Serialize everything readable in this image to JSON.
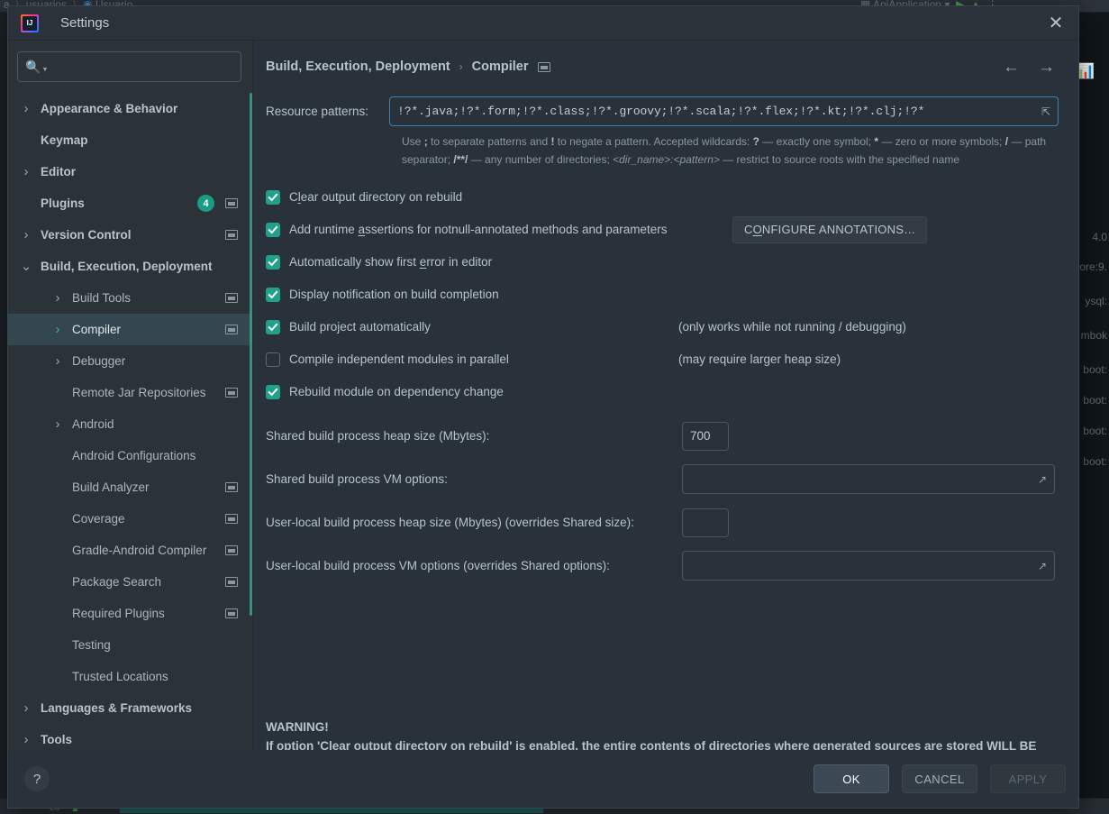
{
  "backdrop": {
    "breadcrumb_left": "a",
    "breadcrumb_mid": "usuarios",
    "breadcrumb_right": "Usuario",
    "run_config": "ApiApplication",
    "right_icon": "profiler-icon",
    "dependencies": [
      "4.0",
      "ore:9.",
      "ysql:",
      "mbok",
      "boot:",
      "boot:",
      "boot:",
      "boot:"
    ],
    "status_count": "20"
  },
  "dialog": {
    "title": "Settings",
    "logo": "intellij-idea-logo",
    "close_label": "✕"
  },
  "search": {
    "value": "",
    "placeholder": ""
  },
  "sidebar": {
    "items": [
      {
        "label": "Appearance & Behavior",
        "arrow": "collapsed",
        "indent": 0,
        "bold": true,
        "badge": null,
        "project_icon": false,
        "selected": false
      },
      {
        "label": "Keymap",
        "arrow": "none",
        "indent": 0,
        "bold": true,
        "badge": null,
        "project_icon": false,
        "selected": false
      },
      {
        "label": "Editor",
        "arrow": "collapsed",
        "indent": 0,
        "bold": true,
        "badge": null,
        "project_icon": false,
        "selected": false
      },
      {
        "label": "Plugins",
        "arrow": "none",
        "indent": 0,
        "bold": true,
        "badge": "4",
        "project_icon": true,
        "selected": false
      },
      {
        "label": "Version Control",
        "arrow": "collapsed",
        "indent": 0,
        "bold": true,
        "badge": null,
        "project_icon": true,
        "selected": false
      },
      {
        "label": "Build, Execution, Deployment",
        "arrow": "expanded",
        "indent": 0,
        "bold": true,
        "badge": null,
        "project_icon": false,
        "selected": false
      },
      {
        "label": "Build Tools",
        "arrow": "collapsed",
        "indent": 1,
        "bold": false,
        "badge": null,
        "project_icon": true,
        "selected": false
      },
      {
        "label": "Compiler",
        "arrow": "collapsed",
        "indent": 1,
        "bold": false,
        "badge": null,
        "project_icon": true,
        "selected": true
      },
      {
        "label": "Debugger",
        "arrow": "collapsed",
        "indent": 1,
        "bold": false,
        "badge": null,
        "project_icon": false,
        "selected": false
      },
      {
        "label": "Remote Jar Repositories",
        "arrow": "none",
        "indent": 1,
        "bold": false,
        "badge": null,
        "project_icon": true,
        "selected": false
      },
      {
        "label": "Android",
        "arrow": "collapsed",
        "indent": 1,
        "bold": false,
        "badge": null,
        "project_icon": false,
        "selected": false
      },
      {
        "label": "Android Configurations",
        "arrow": "none",
        "indent": 1,
        "bold": false,
        "badge": null,
        "project_icon": false,
        "selected": false
      },
      {
        "label": "Build Analyzer",
        "arrow": "none",
        "indent": 1,
        "bold": false,
        "badge": null,
        "project_icon": true,
        "selected": false
      },
      {
        "label": "Coverage",
        "arrow": "none",
        "indent": 1,
        "bold": false,
        "badge": null,
        "project_icon": true,
        "selected": false
      },
      {
        "label": "Gradle-Android Compiler",
        "arrow": "none",
        "indent": 1,
        "bold": false,
        "badge": null,
        "project_icon": true,
        "selected": false
      },
      {
        "label": "Package Search",
        "arrow": "none",
        "indent": 1,
        "bold": false,
        "badge": null,
        "project_icon": true,
        "selected": false
      },
      {
        "label": "Required Plugins",
        "arrow": "none",
        "indent": 1,
        "bold": false,
        "badge": null,
        "project_icon": true,
        "selected": false
      },
      {
        "label": "Testing",
        "arrow": "none",
        "indent": 1,
        "bold": false,
        "badge": null,
        "project_icon": false,
        "selected": false
      },
      {
        "label": "Trusted Locations",
        "arrow": "none",
        "indent": 1,
        "bold": false,
        "badge": null,
        "project_icon": false,
        "selected": false
      },
      {
        "label": "Languages & Frameworks",
        "arrow": "collapsed",
        "indent": 0,
        "bold": true,
        "badge": null,
        "project_icon": false,
        "selected": false
      },
      {
        "label": "Tools",
        "arrow": "collapsed",
        "indent": 0,
        "bold": true,
        "badge": null,
        "project_icon": false,
        "selected": false
      }
    ]
  },
  "breadcrumb": {
    "root": "Build, Execution, Deployment",
    "separator": "›",
    "leaf": "Compiler",
    "project_icon": "project-scope-icon",
    "back": "←",
    "forward": "→"
  },
  "resource_patterns": {
    "label": "Resource patterns:",
    "value": "!?*.java;!?*.form;!?*.class;!?*.groovy;!?*.scala;!?*.flex;!?*.kt;!?*.clj;!?*",
    "expand_icon": "expand-editor-icon",
    "hint_html": "Use <b>;</b> to separate patterns and <b>!</b> to negate a pattern. Accepted wildcards: <b>?</b> — exactly one symbol; <b>*</b> — zero or more symbols; <b>/</b> — path separator; <b>/**/</b> — any number of directories; <i>&lt;dir_name&gt;:&lt;pattern&gt;</i> — restrict to source roots with the specified name"
  },
  "checkboxes": [
    {
      "label_html": "C<u>l</u>ear output directory on rebuild",
      "checked": true,
      "note": null,
      "button": null
    },
    {
      "label_html": "Add runtime <u>a</u>ssertions for notnull-annotated methods and parameters",
      "checked": true,
      "note": null,
      "button": "C<u>O</u>NFIGURE ANNOTATIONS…"
    },
    {
      "label_html": "Automatically show first <u>e</u>rror in editor",
      "checked": true,
      "note": null,
      "button": null
    },
    {
      "label_html": "Display notification on build completion",
      "checked": true,
      "note": null,
      "button": null
    },
    {
      "label_html": "Build project automatically",
      "checked": true,
      "note": "(only works while not running / debugging)",
      "button": null
    },
    {
      "label_html": "Compile independent modules in parallel",
      "checked": false,
      "note": "(may require larger heap size)",
      "button": null
    },
    {
      "label_html": "Rebuild module on dependency change",
      "checked": true,
      "note": null,
      "button": null
    }
  ],
  "fields": [
    {
      "label": "Shared build process heap size (Mbytes):",
      "value": "700",
      "size": "small",
      "expandable": false
    },
    {
      "label": "Shared build process VM options:",
      "value": "",
      "size": "large",
      "expandable": true
    },
    {
      "label": "User-local build process heap size (Mbytes) (overrides Shared size):",
      "value": "",
      "size": "small",
      "expandable": false
    },
    {
      "label": "User-local build process VM options (overrides Shared options):",
      "value": "",
      "size": "large",
      "expandable": true
    }
  ],
  "warning": {
    "line1": "WARNING!",
    "line2": "If option 'Clear output directory on rebuild' is enabled, the entire contents of directories where generated sources are stored WILL BE CLEARED on rebuild."
  },
  "footer": {
    "help": "?",
    "ok": "OK",
    "cancel": "CANCEL",
    "apply": "APPLY"
  },
  "colors": {
    "accent_teal": "#21a18c",
    "focus_blue": "#3f7fb3",
    "dialog_bg": "#29313a",
    "sidebar_bg": "#2b3238",
    "selection_bg": "#344650"
  }
}
